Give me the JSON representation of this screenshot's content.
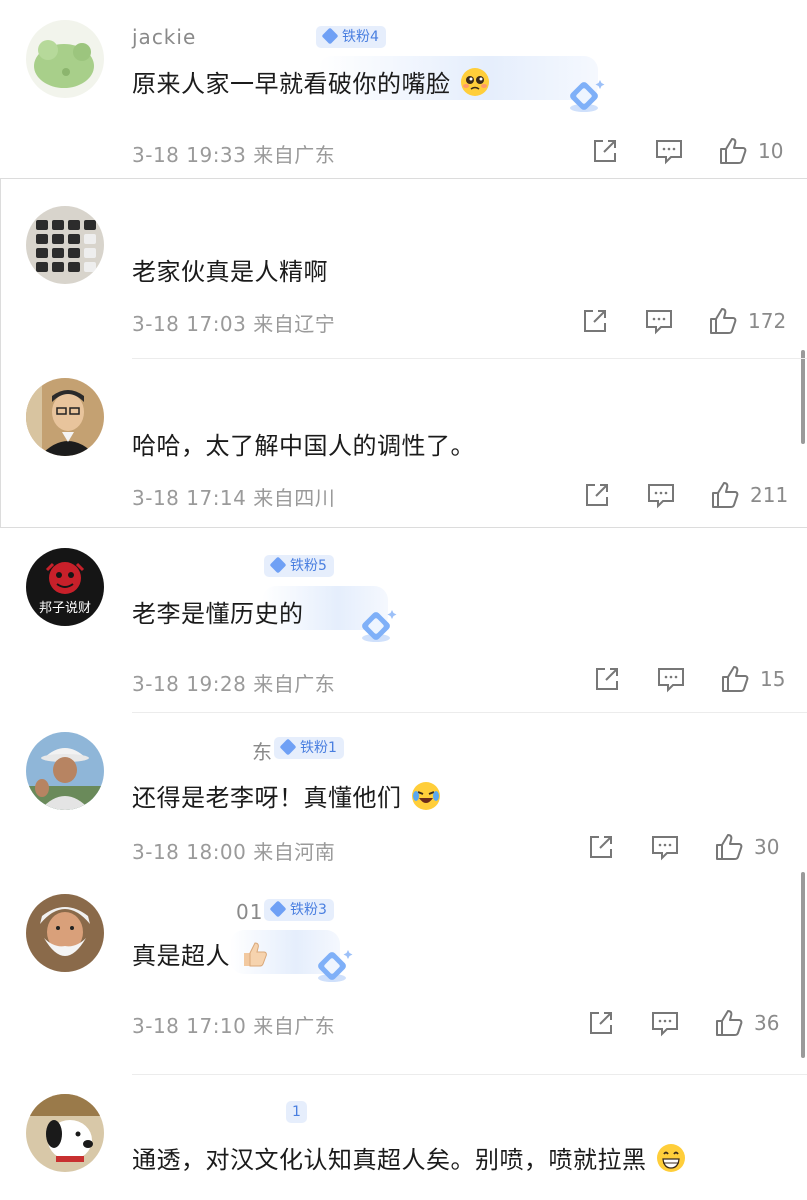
{
  "comments": [
    {
      "name": "jackie",
      "badge": "铁粉4",
      "text": "原来人家一早就看破你的嘴脸",
      "time": "3-18 19:33",
      "location": "来自广东",
      "likes": "10"
    },
    {
      "name": "",
      "badge": "",
      "text": "老家伙真是人精啊",
      "time": "3-18 17:03",
      "location": "来自辽宁",
      "likes": "172"
    },
    {
      "name": "",
      "badge": "",
      "text": "哈哈，太了解中国人的调性了。",
      "time": "3-18 17:14",
      "location": "来自四川",
      "likes": "211"
    },
    {
      "name": "",
      "badge": "铁粉5",
      "text": "老李是懂历史的",
      "time": "3-18 19:28",
      "location": "来自广东",
      "likes": "15"
    },
    {
      "name": "东",
      "badge": "铁粉1",
      "text": "还得是老李呀！真懂他们",
      "time": "3-18 18:00",
      "location": "来自河南",
      "likes": "30"
    },
    {
      "name": "01",
      "badge": "铁粉3",
      "text": "真是超人",
      "time": "3-18 17:10",
      "location": "来自广东",
      "likes": "36"
    },
    {
      "name": "",
      "badge": "1",
      "text": "通透，对汉文化认知真超人矣。别喷，喷就拉黑",
      "time": "",
      "location": "",
      "likes": ""
    }
  ],
  "avatar_labels": {
    "c3": "邦子说财"
  },
  "colors": {
    "badge_bg": "#e6eefc",
    "badge_text": "#4a7fe0",
    "meta": "#9a9a9a",
    "text": "#1b1b1b"
  },
  "icons": {
    "share": "share-icon",
    "reply": "comment-icon",
    "like": "thumbs-up-icon"
  }
}
